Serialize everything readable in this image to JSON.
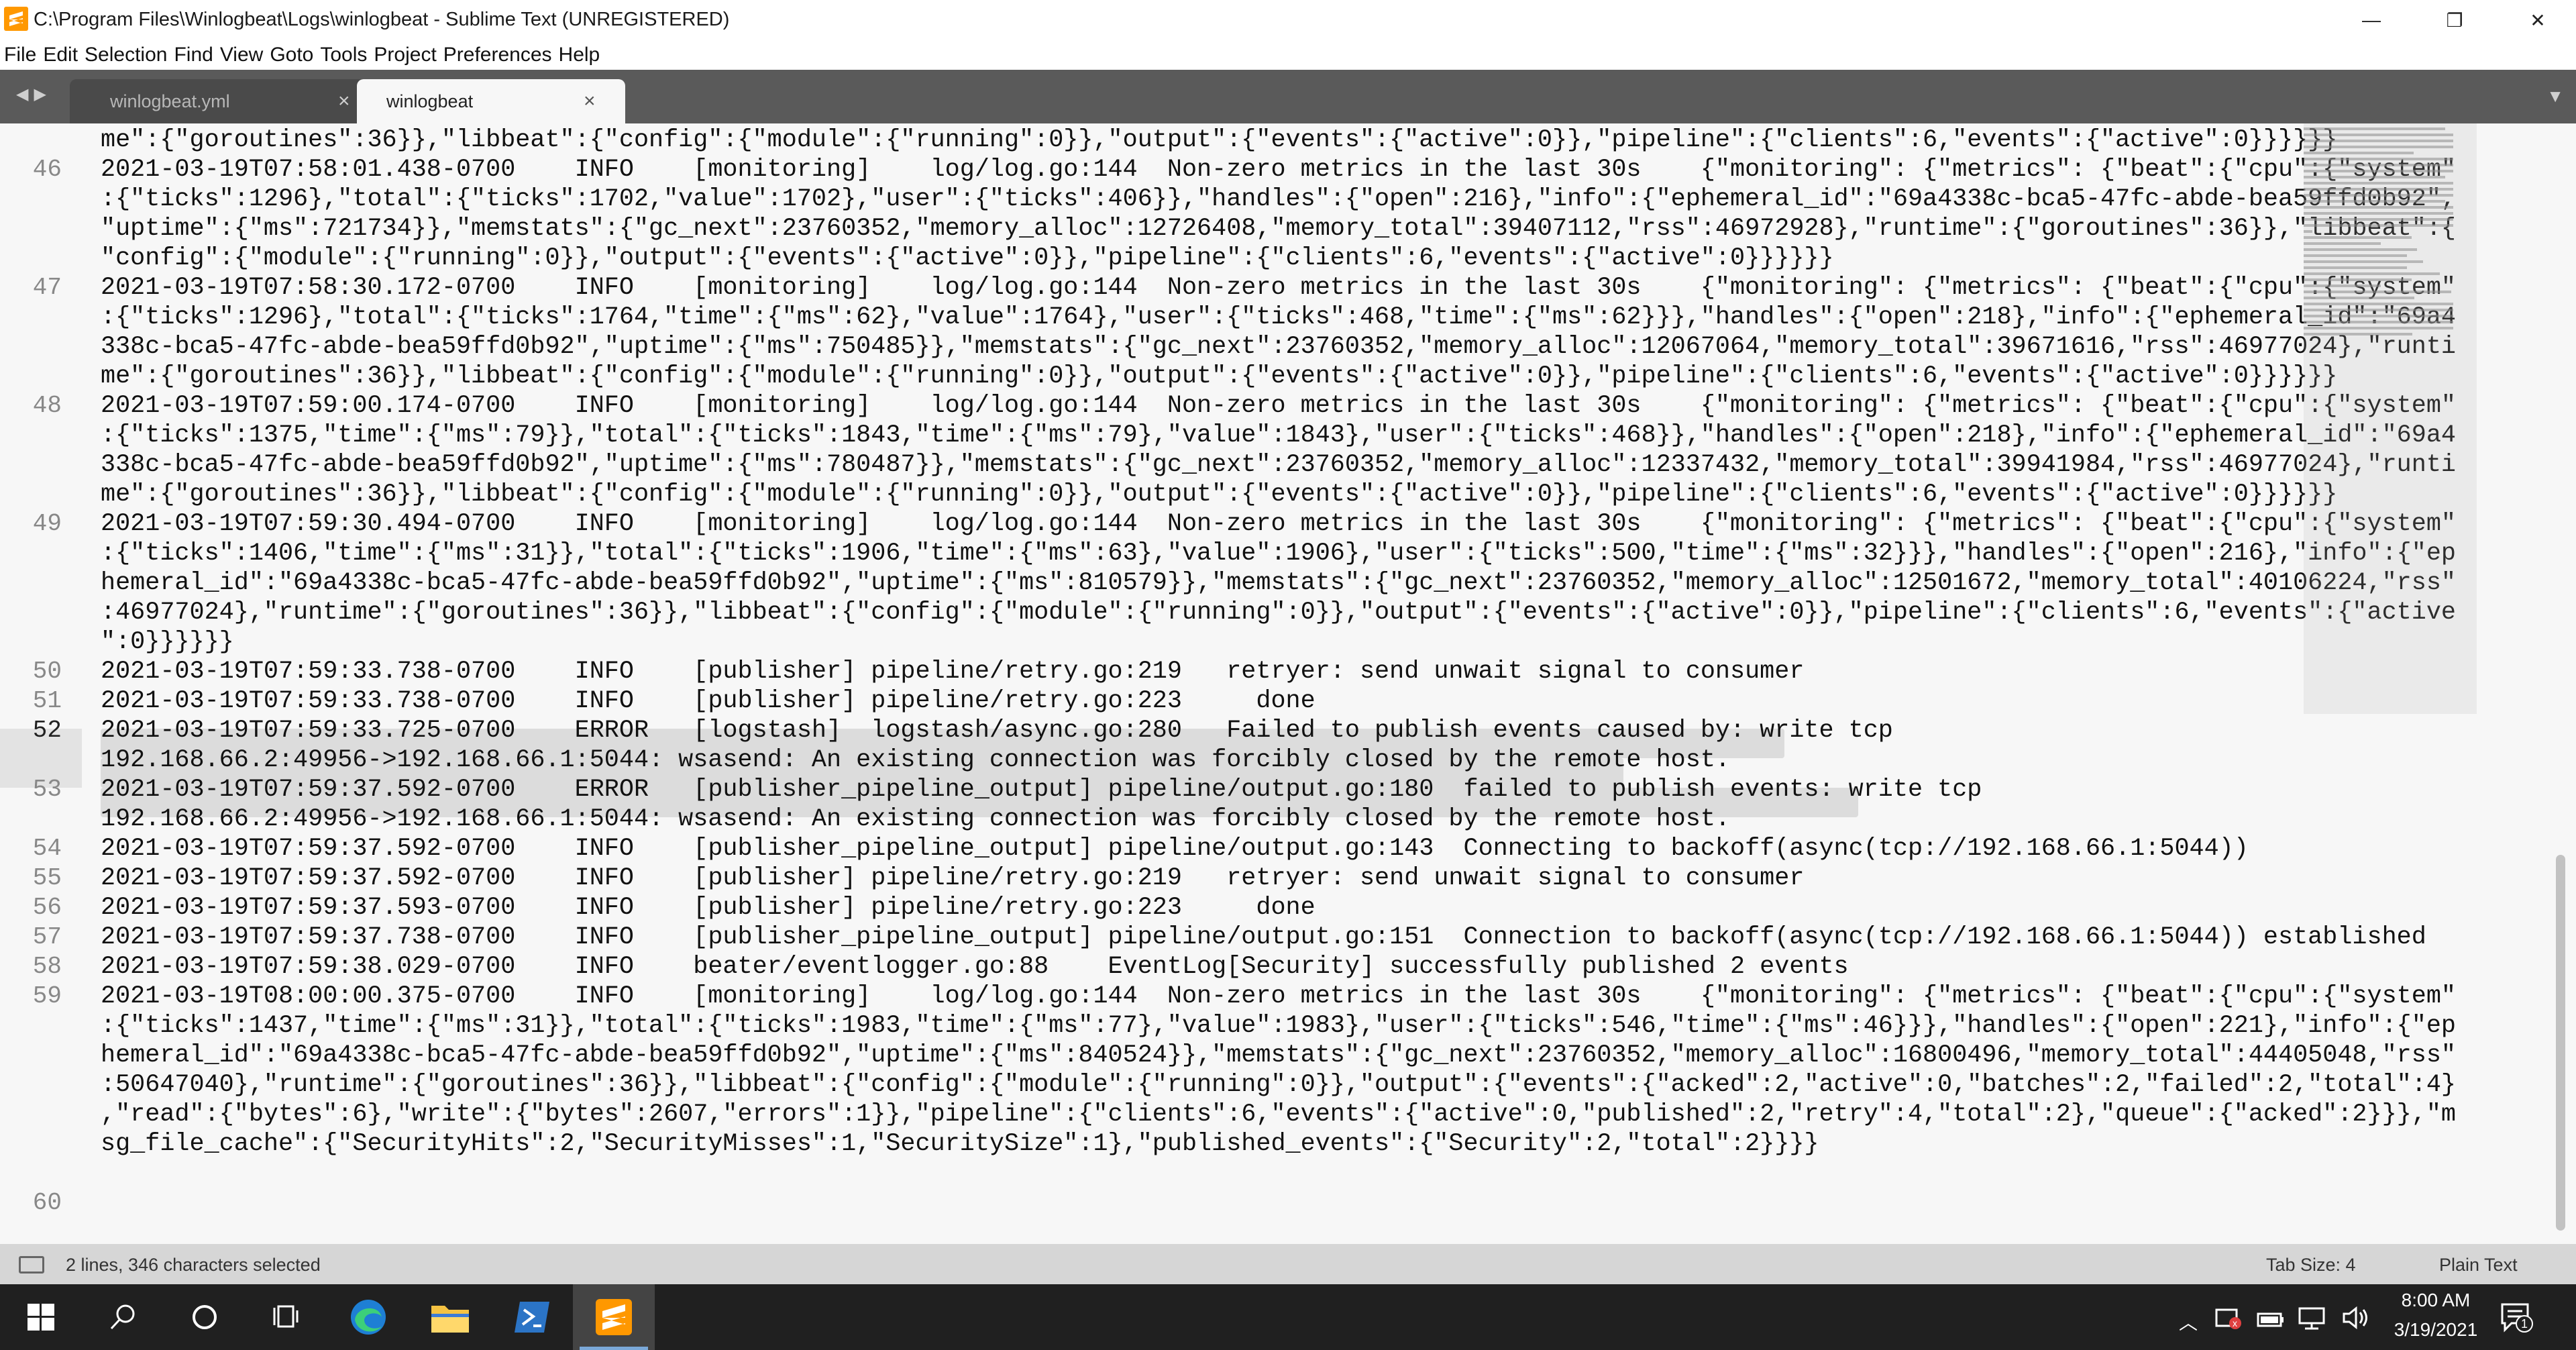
{
  "window": {
    "title": "C:\\Program Files\\Winlogbeat\\Logs\\winlogbeat - Sublime Text (UNREGISTERED)",
    "minimize": "—",
    "restore": "❐",
    "close": "✕"
  },
  "menu": [
    "File",
    "Edit",
    "Selection",
    "Find",
    "View",
    "Goto",
    "Tools",
    "Project",
    "Preferences",
    "Help"
  ],
  "tabs": [
    {
      "label": "winlogbeat.yml",
      "active": false
    },
    {
      "label": "winlogbeat",
      "active": true
    }
  ],
  "editor": {
    "rows": [
      {
        "num": "",
        "text": "me\":{\"goroutines\":36}},\"libbeat\":{\"config\":{\"module\":{\"running\":0}},\"output\":{\"events\":{\"active\":0}},\"pipeline\":{\"clients\":6,\"events\":{\"active\":0}}}}}}"
      },
      {
        "num": "46",
        "text": "2021-03-19T07:58:01.438-0700    INFO    [monitoring]    log/log.go:144  Non-zero metrics in the last 30s    {\"monitoring\": {\"metrics\": {\"beat\":{\"cpu\":{\"system\""
      },
      {
        "num": "",
        "text": ":{\"ticks\":1296},\"total\":{\"ticks\":1702,\"value\":1702},\"user\":{\"ticks\":406}},\"handles\":{\"open\":216},\"info\":{\"ephemeral_id\":\"69a4338c-bca5-47fc-abde-bea59ffd0b92\","
      },
      {
        "num": "",
        "text": "\"uptime\":{\"ms\":721734}},\"memstats\":{\"gc_next\":23760352,\"memory_alloc\":12726408,\"memory_total\":39407112,\"rss\":46972928},\"runtime\":{\"goroutines\":36}},\"libbeat\":{"
      },
      {
        "num": "",
        "text": "\"config\":{\"module\":{\"running\":0}},\"output\":{\"events\":{\"active\":0}},\"pipeline\":{\"clients\":6,\"events\":{\"active\":0}}}}}}"
      },
      {
        "num": "47",
        "text": "2021-03-19T07:58:30.172-0700    INFO    [monitoring]    log/log.go:144  Non-zero metrics in the last 30s    {\"monitoring\": {\"metrics\": {\"beat\":{\"cpu\":{\"system\""
      },
      {
        "num": "",
        "text": ":{\"ticks\":1296},\"total\":{\"ticks\":1764,\"time\":{\"ms\":62},\"value\":1764},\"user\":{\"ticks\":468,\"time\":{\"ms\":62}}},\"handles\":{\"open\":218},\"info\":{\"ephemeral_id\":\"69a4"
      },
      {
        "num": "",
        "text": "338c-bca5-47fc-abde-bea59ffd0b92\",\"uptime\":{\"ms\":750485}},\"memstats\":{\"gc_next\":23760352,\"memory_alloc\":12067064,\"memory_total\":39671616,\"rss\":46977024},\"runti"
      },
      {
        "num": "",
        "text": "me\":{\"goroutines\":36}},\"libbeat\":{\"config\":{\"module\":{\"running\":0}},\"output\":{\"events\":{\"active\":0}},\"pipeline\":{\"clients\":6,\"events\":{\"active\":0}}}}}}"
      },
      {
        "num": "48",
        "text": "2021-03-19T07:59:00.174-0700    INFO    [monitoring]    log/log.go:144  Non-zero metrics in the last 30s    {\"monitoring\": {\"metrics\": {\"beat\":{\"cpu\":{\"system\""
      },
      {
        "num": "",
        "text": ":{\"ticks\":1375,\"time\":{\"ms\":79}},\"total\":{\"ticks\":1843,\"time\":{\"ms\":79},\"value\":1843},\"user\":{\"ticks\":468}},\"handles\":{\"open\":218},\"info\":{\"ephemeral_id\":\"69a4"
      },
      {
        "num": "",
        "text": "338c-bca5-47fc-abde-bea59ffd0b92\",\"uptime\":{\"ms\":780487}},\"memstats\":{\"gc_next\":23760352,\"memory_alloc\":12337432,\"memory_total\":39941984,\"rss\":46977024},\"runti"
      },
      {
        "num": "",
        "text": "me\":{\"goroutines\":36}},\"libbeat\":{\"config\":{\"module\":{\"running\":0}},\"output\":{\"events\":{\"active\":0}},\"pipeline\":{\"clients\":6,\"events\":{\"active\":0}}}}}}"
      },
      {
        "num": "49",
        "text": "2021-03-19T07:59:30.494-0700    INFO    [monitoring]    log/log.go:144  Non-zero metrics in the last 30s    {\"monitoring\": {\"metrics\": {\"beat\":{\"cpu\":{\"system\""
      },
      {
        "num": "",
        "text": ":{\"ticks\":1406,\"time\":{\"ms\":31}},\"total\":{\"ticks\":1906,\"time\":{\"ms\":63},\"value\":1906},\"user\":{\"ticks\":500,\"time\":{\"ms\":32}}},\"handles\":{\"open\":216},\"info\":{\"ep"
      },
      {
        "num": "",
        "text": "hemeral_id\":\"69a4338c-bca5-47fc-abde-bea59ffd0b92\",\"uptime\":{\"ms\":810579}},\"memstats\":{\"gc_next\":23760352,\"memory_alloc\":12501672,\"memory_total\":40106224,\"rss\""
      },
      {
        "num": "",
        "text": ":46977024},\"runtime\":{\"goroutines\":36}},\"libbeat\":{\"config\":{\"module\":{\"running\":0}},\"output\":{\"events\":{\"active\":0}},\"pipeline\":{\"clients\":6,\"events\":{\"active"
      },
      {
        "num": "",
        "text": "\":0}}}}}}"
      },
      {
        "num": "50",
        "text": "2021-03-19T07:59:33.738-0700    INFO    [publisher] pipeline/retry.go:219   retryer: send unwait signal to consumer"
      },
      {
        "num": "51",
        "text": "2021-03-19T07:59:33.738-0700    INFO    [publisher] pipeline/retry.go:223     done"
      },
      {
        "num": "52",
        "text": "2021-03-19T07:59:33.725-0700    ERROR   [logstash]  logstash/async.go:280   Failed to publish events caused by: write tcp"
      },
      {
        "num": "",
        "text": "192.168.66.2:49956->192.168.66.1:5044: wsasend: An existing connection was forcibly closed by the remote host."
      },
      {
        "num": "53",
        "text": "2021-03-19T07:59:37.592-0700    ERROR   [publisher_pipeline_output] pipeline/output.go:180  failed to publish events: write tcp"
      },
      {
        "num": "",
        "text": "192.168.66.2:49956->192.168.66.1:5044: wsasend: An existing connection was forcibly closed by the remote host."
      },
      {
        "num": "54",
        "text": "2021-03-19T07:59:37.592-0700    INFO    [publisher_pipeline_output] pipeline/output.go:143  Connecting to backoff(async(tcp://192.168.66.1:5044))"
      },
      {
        "num": "55",
        "text": "2021-03-19T07:59:37.592-0700    INFO    [publisher] pipeline/retry.go:219   retryer: send unwait signal to consumer"
      },
      {
        "num": "56",
        "text": "2021-03-19T07:59:37.593-0700    INFO    [publisher] pipeline/retry.go:223     done"
      },
      {
        "num": "57",
        "text": "2021-03-19T07:59:37.738-0700    INFO    [publisher_pipeline_output] pipeline/output.go:151  Connection to backoff(async(tcp://192.168.66.1:5044)) established"
      },
      {
        "num": "58",
        "text": "2021-03-19T07:59:38.029-0700    INFO    beater/eventlogger.go:88    EventLog[Security] successfully published 2 events"
      },
      {
        "num": "59",
        "text": "2021-03-19T08:00:00.375-0700    INFO    [monitoring]    log/log.go:144  Non-zero metrics in the last 30s    {\"monitoring\": {\"metrics\": {\"beat\":{\"cpu\":{\"system\""
      },
      {
        "num": "",
        "text": ":{\"ticks\":1437,\"time\":{\"ms\":31}},\"total\":{\"ticks\":1983,\"time\":{\"ms\":77},\"value\":1983},\"user\":{\"ticks\":546,\"time\":{\"ms\":46}}},\"handles\":{\"open\":221},\"info\":{\"ep"
      },
      {
        "num": "",
        "text": "hemeral_id\":\"69a4338c-bca5-47fc-abde-bea59ffd0b92\",\"uptime\":{\"ms\":840524}},\"memstats\":{\"gc_next\":23760352,\"memory_alloc\":16800496,\"memory_total\":44405048,\"rss\""
      },
      {
        "num": "",
        "text": ":50647040},\"runtime\":{\"goroutines\":36}},\"libbeat\":{\"config\":{\"module\":{\"running\":0}},\"output\":{\"events\":{\"acked\":2,\"active\":0,\"batches\":2,\"failed\":2,\"total\":4}"
      },
      {
        "num": "",
        "text": ",\"read\":{\"bytes\":6},\"write\":{\"bytes\":2607,\"errors\":1}},\"pipeline\":{\"clients\":6,\"events\":{\"active\":0,\"published\":2,\"retry\":4,\"total\":2},\"queue\":{\"acked\":2}}},\"m"
      },
      {
        "num": "",
        "text": "sg_file_cache\":{\"SecurityHits\":2,\"SecurityMisses\":1,\"SecuritySize\":1},\"published_events\":{\"Security\":2,\"total\":2}}}}"
      },
      {
        "num": "",
        "text": ""
      },
      {
        "num": "60",
        "text": ""
      }
    ]
  },
  "status": {
    "selection": "2 lines, 346 characters selected",
    "tab_size": "Tab Size: 4",
    "syntax": "Plain Text"
  },
  "taskbar": {
    "time": "8:00 AM",
    "date": "3/19/2021",
    "notification_count": "1"
  }
}
